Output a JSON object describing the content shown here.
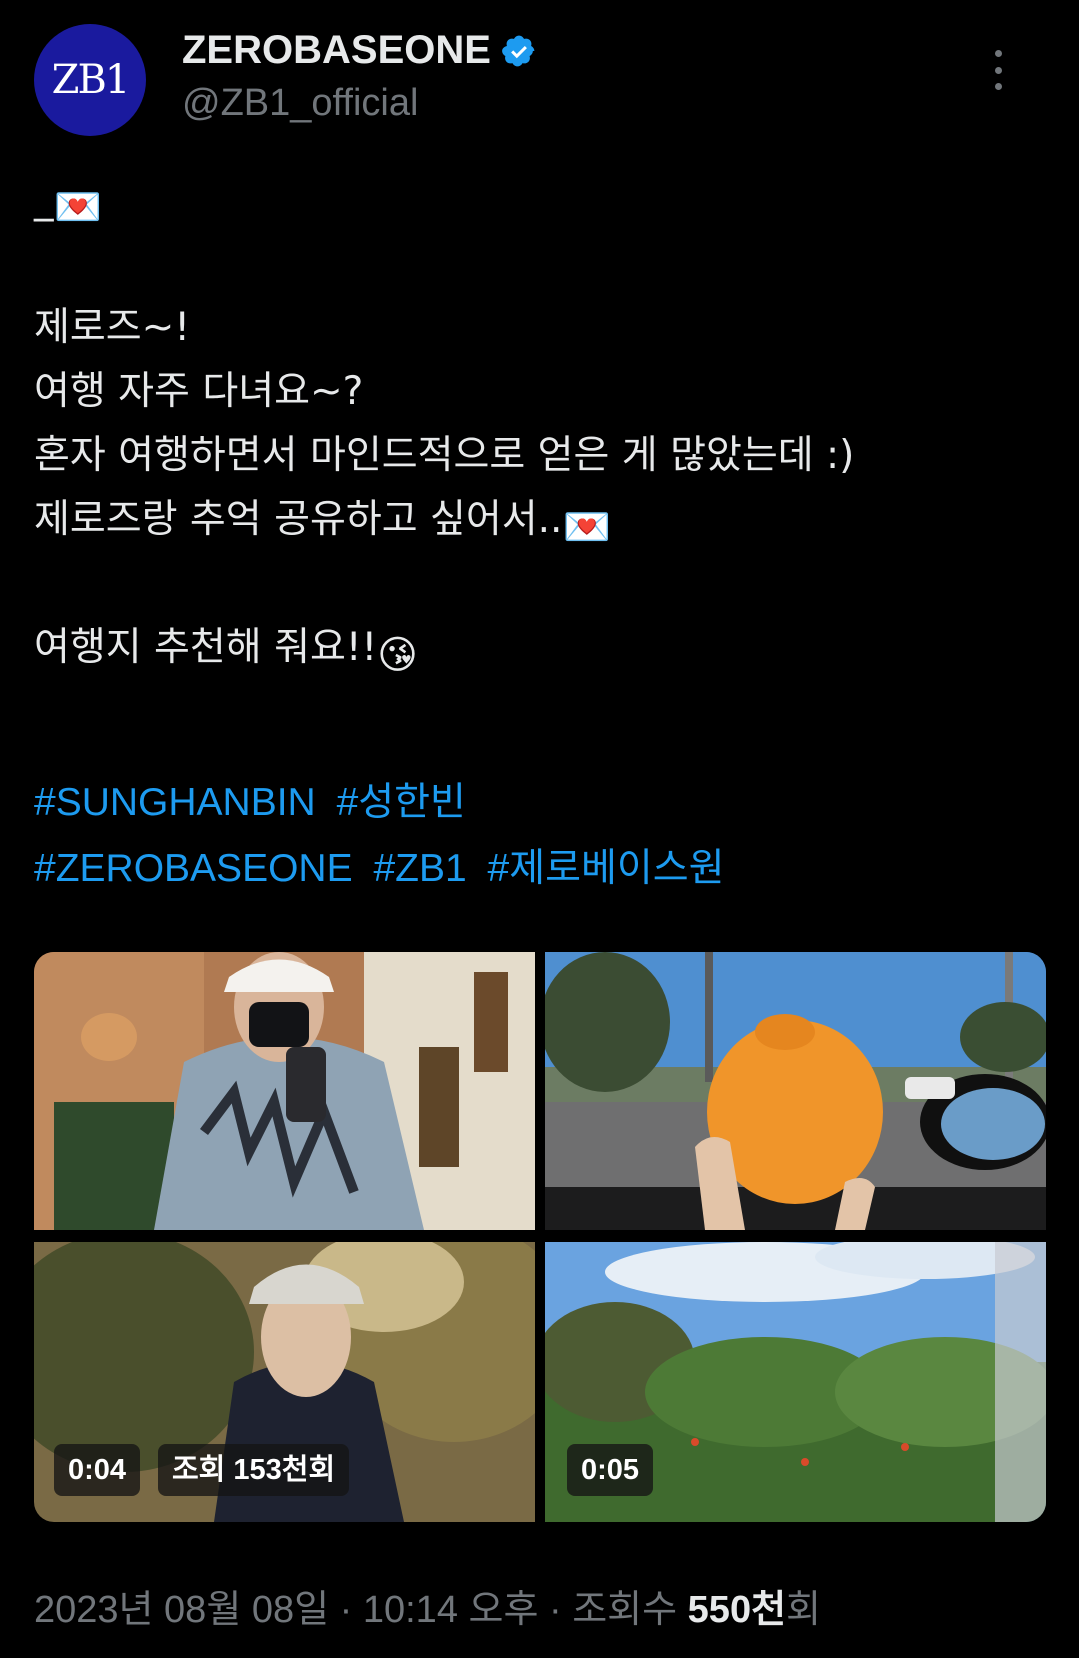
{
  "author": {
    "avatar_text": "ZB1",
    "display_name": "ZEROBASEONE",
    "handle": "@ZB1_official",
    "verified_color": "#1d9bf0"
  },
  "tweet": {
    "lines": [
      "_",
      "",
      "제로즈~!",
      "여행 자주 다녀요~?",
      "혼자 여행하면서 마인드적으로 얻은 게 많았는데 :)",
      "제로즈랑 추억 공유하고 싶어서..",
      "",
      "여행지 추천해 줘요!!"
    ],
    "emojis": {
      "love_letter": "💌",
      "kiss_face": "😘"
    },
    "hashtags_row1": [
      "#SUNGHANBIN",
      "#성한빈"
    ],
    "hashtags_row2": [
      "#ZEROBASEONE",
      "#ZB1",
      "#제로베이스원"
    ]
  },
  "media": {
    "tiles": [
      {
        "name": "mirror-selfie-photo"
      },
      {
        "name": "tangerine-car-photo"
      },
      {
        "name": "outdoor-video",
        "duration": "0:04",
        "views": "조회 153천회"
      },
      {
        "name": "bushes-video",
        "duration": "0:05"
      }
    ]
  },
  "footer": {
    "date": "2023년 08월 08일",
    "sep1": " · ",
    "time": "10:14 오후",
    "sep2": " · ",
    "views_label": "조회수 ",
    "views_count": "550천",
    "views_suffix": "회"
  },
  "colors": {
    "background": "#000000",
    "text": "#e7e9ea",
    "muted": "#71767b",
    "link": "#1d9bf0",
    "avatar_bg": "#1a1a9e"
  }
}
